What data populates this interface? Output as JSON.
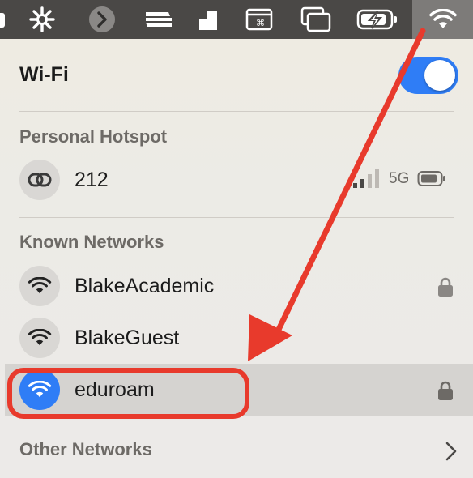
{
  "menubar": {
    "icons": [
      "app-edge-icon",
      "sun-settings-icon",
      "chevron-right-circle-icon",
      "lines-icon",
      "wedge-icon",
      "cmd-window-icon",
      "window-stack-icon",
      "battery-charging-icon",
      "wifi-icon"
    ]
  },
  "wifi_panel": {
    "title": "Wi-Fi",
    "toggle_on": true,
    "personal_hotspot": {
      "heading": "Personal Hotspot",
      "network": {
        "name": "212",
        "signal_bars": 2,
        "network_type": "5G",
        "icon": "link-icon"
      }
    },
    "known_networks": {
      "heading": "Known Networks",
      "items": [
        {
          "name": "BlakeAcademic",
          "secured": true,
          "selected": false,
          "icon": "wifi-icon"
        },
        {
          "name": "BlakeGuest",
          "secured": false,
          "selected": false,
          "icon": "wifi-icon"
        },
        {
          "name": "eduroam",
          "secured": true,
          "selected": true,
          "icon": "wifi-icon"
        }
      ]
    },
    "other_networks": {
      "label": "Other Networks"
    }
  },
  "colors": {
    "accent": "#2f7df6",
    "annotation": "#e83a2c",
    "menubar": "#4a4846"
  }
}
